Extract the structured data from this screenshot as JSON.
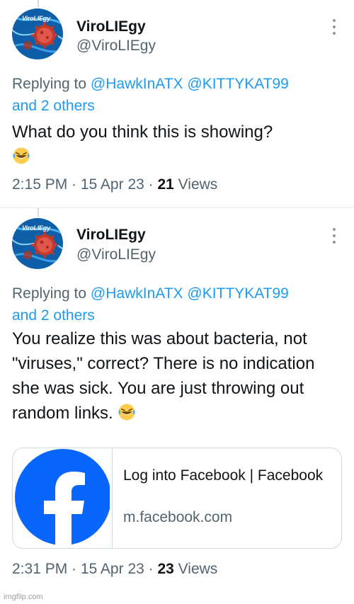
{
  "tweets": [
    {
      "author": {
        "name": "ViroLIEgy",
        "handle": "@ViroLIEgy",
        "avatar_text": "ViroLIEgy"
      },
      "reply": {
        "prefix": "Replying to ",
        "mention1": "@HawkInATX",
        "mention2": "@KITTYKAT99",
        "others": "and 2 others"
      },
      "text": "What do you think this is showing?",
      "emoji": "rolling-on-floor-laughing",
      "time": "2:15 PM",
      "date": "15 Apr 23",
      "views_count": "21",
      "views_label": "Views"
    },
    {
      "author": {
        "name": "ViroLIEgy",
        "handle": "@ViroLIEgy",
        "avatar_text": "ViroLIEgy"
      },
      "reply": {
        "prefix": "Replying to ",
        "mention1": "@HawkInATX",
        "mention2": "@KITTYKAT99",
        "others": "and 2 others"
      },
      "text": "You realize this was about bacteria, not \"viruses,\" correct? There is no indication she was sick. You are just throwing out random links.",
      "emoji": "rolling-on-floor-laughing",
      "card": {
        "title": "Log into Facebook | Facebook",
        "domain": "m.facebook.com",
        "thumb_icon": "facebook-logo"
      },
      "time": "2:31 PM",
      "date": "15 Apr 23",
      "views_count": "23",
      "views_label": "Views"
    }
  ],
  "separator": " · ",
  "watermark": "imgflip.com",
  "colors": {
    "link": "#1d9bf0",
    "secondary": "#536471",
    "facebook_blue": "#0866ff"
  }
}
